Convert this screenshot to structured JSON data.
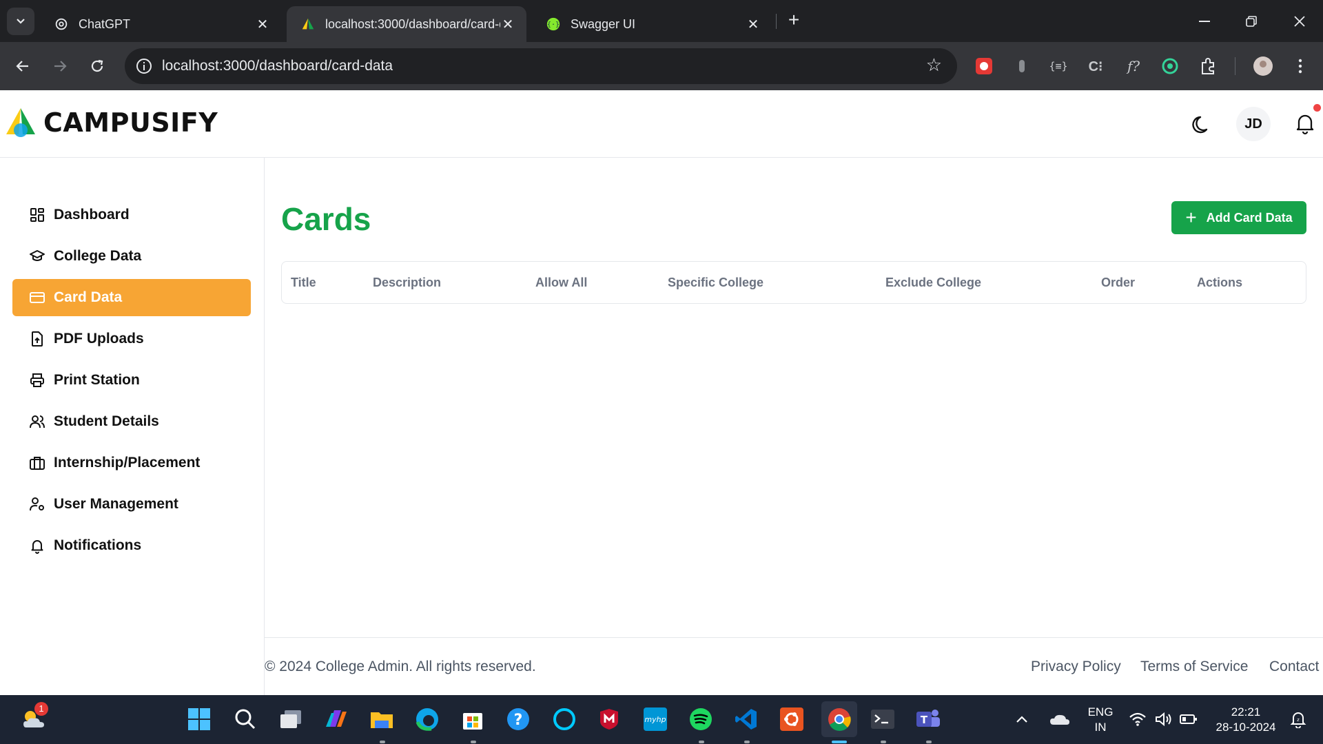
{
  "browser": {
    "tabs": [
      {
        "label": "ChatGPT",
        "icon": "chatgpt-icon"
      },
      {
        "label": "localhost:3000/dashboard/card-data",
        "icon": "campusify-icon"
      },
      {
        "label": "Swagger UI",
        "icon": "swagger-icon"
      }
    ],
    "url": "localhost:3000/dashboard/card-data"
  },
  "app": {
    "brand": "CAMPUSIFY",
    "avatar_initials": "JD"
  },
  "sidebar": {
    "items": [
      {
        "label": "Dashboard",
        "icon": "dashboard-icon"
      },
      {
        "label": "College Data",
        "icon": "graduation-cap-icon"
      },
      {
        "label": "Card Data",
        "icon": "credit-card-icon",
        "active": true
      },
      {
        "label": "PDF Uploads",
        "icon": "file-upload-icon"
      },
      {
        "label": "Print Station",
        "icon": "printer-icon"
      },
      {
        "label": "Student Details",
        "icon": "users-icon"
      },
      {
        "label": "Internship/Placement",
        "icon": "briefcase-icon"
      },
      {
        "label": "User Management",
        "icon": "user-cog-icon"
      },
      {
        "label": "Notifications",
        "icon": "bell-icon"
      }
    ]
  },
  "main": {
    "title": "Cards",
    "add_button": "Add Card Data",
    "table_headers": [
      "Title",
      "Description",
      "Allow All",
      "Specific College",
      "Exclude College",
      "Order",
      "Actions"
    ]
  },
  "footer": {
    "copyright": "© 2024 College Admin. All rights reserved.",
    "links": [
      "Privacy Policy",
      "Terms of Service",
      "Contact"
    ]
  },
  "taskbar": {
    "weather_badge": "1",
    "lang": "ENG",
    "region": "IN",
    "time": "22:21",
    "date": "28-10-2024"
  },
  "colors": {
    "accent_green": "#16a34a",
    "active_orange": "#f7a534"
  }
}
